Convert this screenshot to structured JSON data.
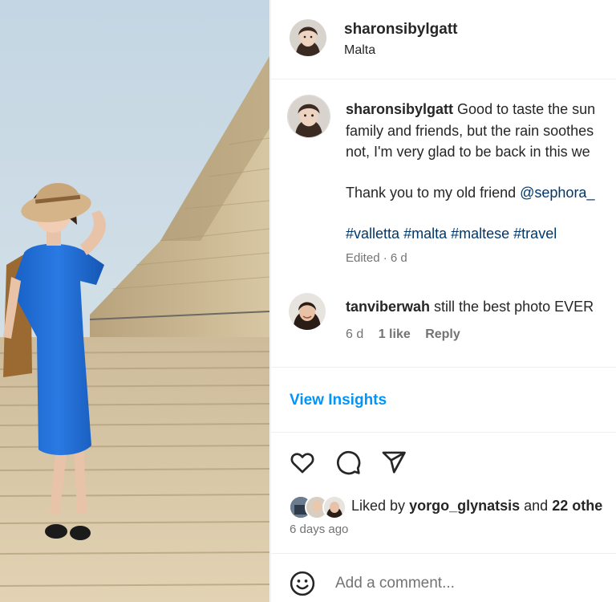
{
  "post": {
    "username": "sharonsibylgatt",
    "location": "Malta",
    "caption": {
      "username": "sharonsibylgatt",
      "line1": "Good to taste the sun",
      "line2": "family and friends, but the rain soothes",
      "line3": "not, I'm very glad to be back in this we",
      "thanks_text": "Thank you to my old friend",
      "mention": "@sephora_",
      "hashtags": [
        "#valletta",
        "#malta",
        "#maltese",
        "#travel"
      ],
      "edited": "Edited · 6 d"
    },
    "comment": {
      "username": "tanviberwah",
      "text": "still the best photo EVER",
      "time": "6 d",
      "likes": "1 like",
      "reply": "Reply"
    },
    "insights_label": "View Insights",
    "icons": {
      "like": "heart-icon",
      "comment": "comment-bubble-icon",
      "share": "paper-plane-icon",
      "emoji": "smiley-icon"
    },
    "liked_by": {
      "prefix": "Liked by",
      "user": "yorgo_glynatsis",
      "and": "and",
      "others": "22 othe"
    },
    "posted_ago": "6 days ago",
    "comment_placeholder": "Add a comment..."
  },
  "colors": {
    "accent": "#0095f6",
    "link": "#00376b",
    "muted": "#737373",
    "dress": "#1f6fd6",
    "sky": "#cfdde6",
    "wall": "#cbb892"
  }
}
